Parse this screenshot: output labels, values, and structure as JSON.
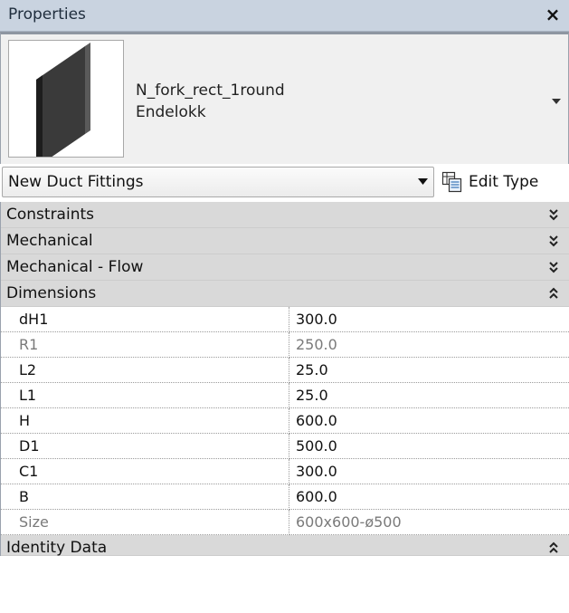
{
  "window": {
    "title": "Properties",
    "close_glyph": "×"
  },
  "type_selector": {
    "family_name": "N_fork_rect_1round",
    "type_name": "Endelokk",
    "thumbnail_icon": "duct-end-cap-preview",
    "dropdown_icon": "dropdown-arrow-icon"
  },
  "instance_selector": {
    "value": "New Duct Fittings",
    "edit_type_label": "Edit Type",
    "edit_type_icon": "edit-type-icon"
  },
  "groups": {
    "constraints": {
      "label": "Constraints",
      "expanded": false
    },
    "mechanical": {
      "label": "Mechanical",
      "expanded": false
    },
    "mechanical_flow": {
      "label": "Mechanical - Flow",
      "expanded": false
    },
    "dimensions": {
      "label": "Dimensions",
      "expanded": true
    },
    "identity_data": {
      "label": "Identity Data",
      "expanded": true
    }
  },
  "dimensions": [
    {
      "name": "dH1",
      "value": "300.0",
      "editable": true
    },
    {
      "name": "R1",
      "value": "250.0",
      "editable": false
    },
    {
      "name": "L2",
      "value": "25.0",
      "editable": true
    },
    {
      "name": "L1",
      "value": "25.0",
      "editable": true
    },
    {
      "name": "H",
      "value": "600.0",
      "editable": true
    },
    {
      "name": "D1",
      "value": "500.0",
      "editable": true
    },
    {
      "name": "C1",
      "value": "300.0",
      "editable": true
    },
    {
      "name": "B",
      "value": "600.0",
      "editable": true
    },
    {
      "name": "Size",
      "value": "600x600-ø500",
      "editable": false
    }
  ],
  "colors": {
    "titlebar": "#c9d3e0",
    "group_header": "#d9d9d9",
    "readonly_text": "#7a7a7a"
  }
}
